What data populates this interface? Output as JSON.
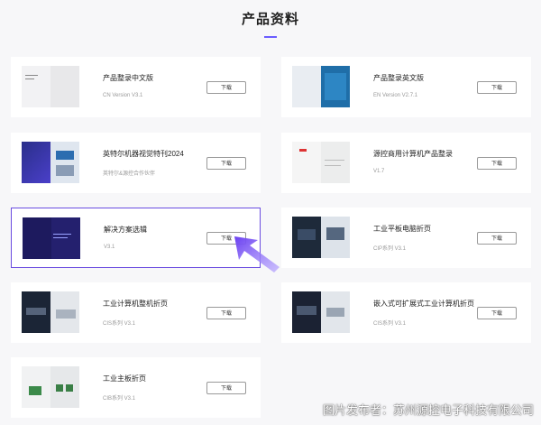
{
  "page": {
    "title": "产品资料"
  },
  "cards": [
    {
      "title": "产品整录中文版",
      "subtitle": "CN Version V3.1",
      "button": "下载"
    },
    {
      "title": "产品整录英文版",
      "subtitle": "EN Version V2.7.1",
      "button": "下载"
    },
    {
      "title": "英特尔机器视觉特刊2024",
      "subtitle": "英特尔&源控合作伙伴",
      "button": "下载"
    },
    {
      "title": "源控商用计算机产品整录",
      "subtitle": "V1.7",
      "button": "下载"
    },
    {
      "title": "解决方案选辑",
      "subtitle": "V3.1",
      "button": "下载"
    },
    {
      "title": "工业平板电脑折页",
      "subtitle": "CIP系列 V3.1",
      "button": "下载"
    },
    {
      "title": "工业计算机整机折页",
      "subtitle": "CIS系列 V3.1",
      "button": "下载"
    },
    {
      "title": "嵌入式可扩展式工业计算机折页",
      "subtitle": "CIS系列 V3.1",
      "button": "下载"
    },
    {
      "title": "工业主板折页",
      "subtitle": "CIB系列 V3.1",
      "button": "下载"
    }
  ],
  "selected_index": 4,
  "watermark": "图片发布者：苏州源控电子科技有限公司",
  "colors": {
    "accent": "#6a4ce0",
    "arrow": "#7b5cf0"
  }
}
